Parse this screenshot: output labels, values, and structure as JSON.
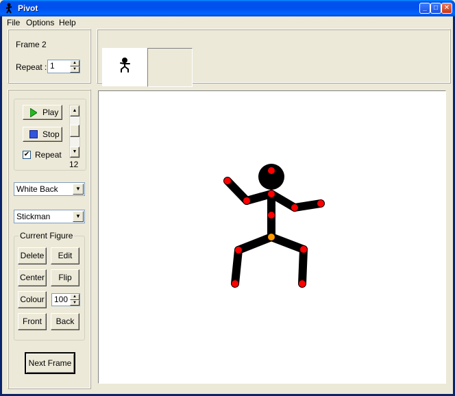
{
  "window": {
    "title": "Pivot"
  },
  "menu": {
    "items": [
      {
        "label": "File"
      },
      {
        "label": "Options"
      },
      {
        "label": "Help"
      }
    ]
  },
  "frame_panel": {
    "frame_label": "Frame 2",
    "repeat_label": "Repeat :",
    "repeat_value": "1"
  },
  "playback": {
    "play_label": "Play",
    "stop_label": "Stop",
    "repeat_label": "Repeat",
    "repeat_checked": true,
    "speed_value": "12"
  },
  "background_select": {
    "value": "White Back"
  },
  "figure_select": {
    "value": "Stickman"
  },
  "current_figure": {
    "title": "Current Figure",
    "delete_label": "Delete",
    "edit_label": "Edit",
    "center_label": "Center",
    "flip_label": "Flip",
    "colour_label": "Colour",
    "colour_value": "100",
    "front_label": "Front",
    "back_label": "Back"
  },
  "next_frame_label": "Next Frame",
  "colors": {
    "joint": "#ff0000",
    "origin_joint": "#ff9900",
    "limb": "#000000",
    "canvas": "#ffffff"
  },
  "icons": {
    "play": "play-triangle-icon",
    "stop": "stop-square-icon",
    "check": "checkmark-icon",
    "up": "arrow-up-icon",
    "down": "arrow-down-icon"
  }
}
